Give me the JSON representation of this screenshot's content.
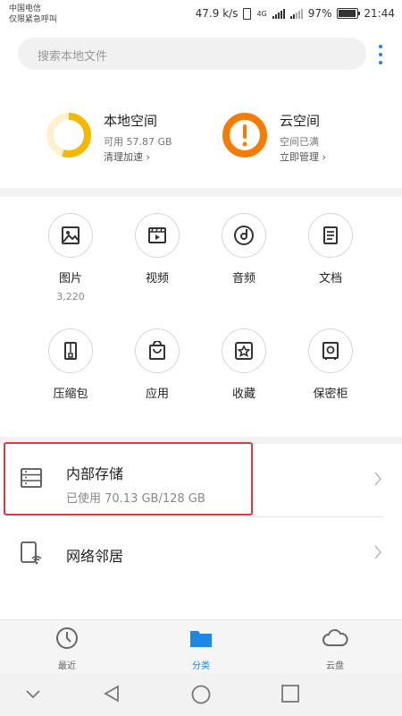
{
  "status_bar": {
    "carrier_line1": "中国电信",
    "carrier_line2": "仅限紧急呼叫",
    "net_speed": "47.9 k/s",
    "network_type": "4G",
    "battery": "97%",
    "battery_level": 0.97,
    "time": "21:44"
  },
  "search": {
    "placeholder": "搜索本地文件",
    "menu_icon": "more-vert-icon"
  },
  "storage_cards": [
    {
      "title": "本地空间",
      "sub": "可用 57.87 GB",
      "link": "清理加速",
      "ring_color": "#f5b800",
      "ring_fraction": 0.55,
      "icon": "ring-gauge-icon"
    },
    {
      "title": "云空间",
      "sub": "空间已满",
      "link": "立即管理",
      "ring_color": "#f57c00",
      "icon": "warning-icon"
    }
  ],
  "categories": [
    {
      "label": "图片",
      "count": "3,220",
      "icon": "image-icon"
    },
    {
      "label": "视频",
      "icon": "video-icon"
    },
    {
      "label": "音频",
      "icon": "music-disc-icon"
    },
    {
      "label": "文档",
      "icon": "document-icon"
    },
    {
      "label": "压缩包",
      "icon": "zip-icon"
    },
    {
      "label": "应用",
      "icon": "app-bag-icon"
    },
    {
      "label": "收藏",
      "icon": "star-icon"
    },
    {
      "label": "保密柜",
      "icon": "safe-icon"
    }
  ],
  "storage_rows": [
    {
      "title": "内部存储",
      "sub": "已使用 70.13 GB/128 GB",
      "icon": "storage-list-icon"
    },
    {
      "title": "网络邻居",
      "icon": "network-device-icon"
    }
  ],
  "bottom_nav": [
    {
      "label": "最近",
      "icon": "clock-icon",
      "active": false
    },
    {
      "label": "分类",
      "icon": "folder-icon",
      "active": true
    },
    {
      "label": "云盘",
      "icon": "cloud-icon",
      "active": false
    }
  ],
  "colors": {
    "accent": "#1e88e5",
    "highlight": "#e53935",
    "local_ring": "#f5b800",
    "cloud_ring": "#f57c00"
  }
}
